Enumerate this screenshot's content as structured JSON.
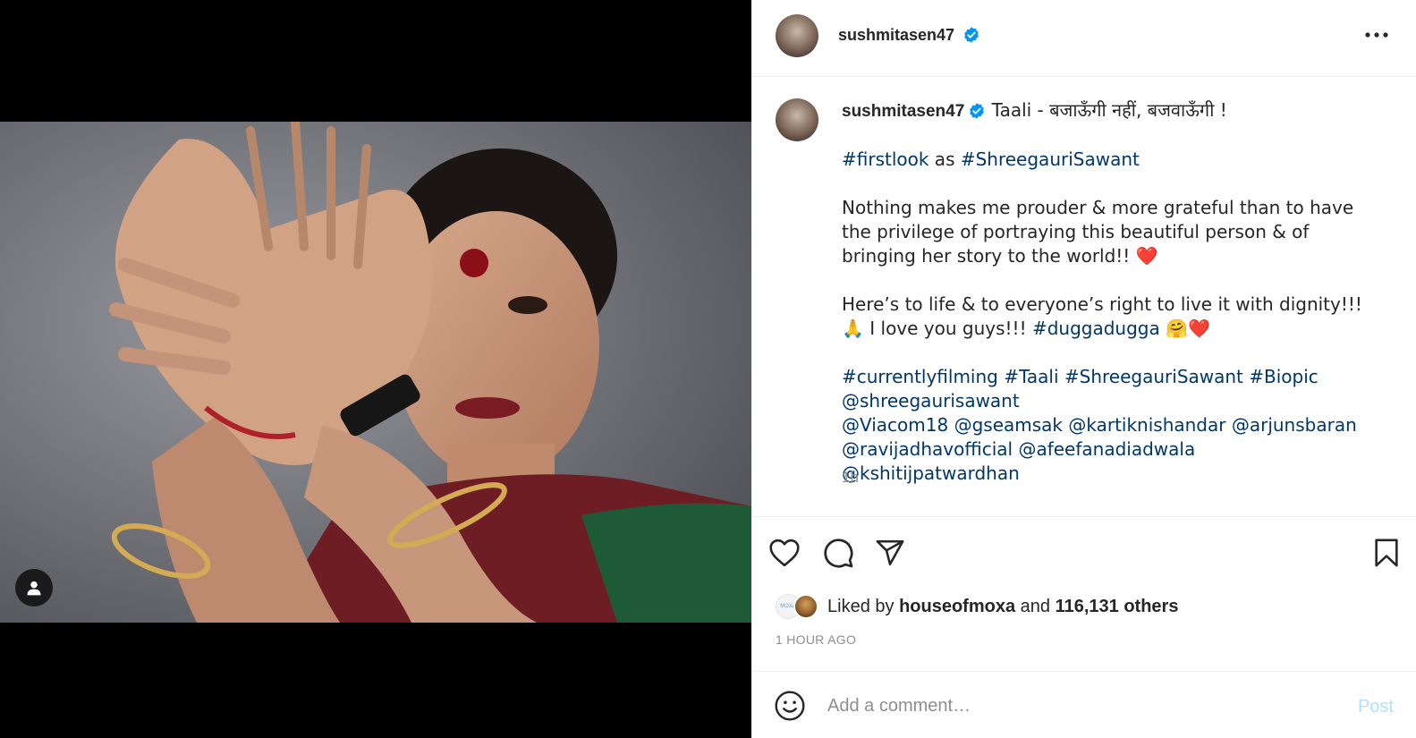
{
  "header": {
    "username": "sushmitasen47",
    "more_icon": "more-horizontal-icon"
  },
  "caption": {
    "username": "sushmitasen47",
    "title_text": "Taali - बजाऊँगी नहीं, बजवाऊँगी !",
    "line2_tag1": "#firstlook",
    "line2_mid": " as ",
    "line2_tag2": "#ShreegauriSawant",
    "para1": "Nothing makes me prouder & more grateful than to have the privilege of portraying this beautiful person & of bringing her story to the world!! ❤️",
    "para2_text": "Here’s to life & to everyone’s right to live it with dignity!!! 🙏 I love you guys!!! ",
    "para2_tag": "#duggadugga",
    "para2_emoji": " 🤗❤️",
    "tags": [
      "#currentlyfilming",
      "#Taali",
      "#ShreegauriSawant",
      "#Biopic",
      "@shreegaurisawant",
      "@Viacom18",
      "@gseamsak",
      "@kartiknishandar",
      "@arjunsbaran",
      "@ravijadhavofficial",
      "@afeefanadiadwala",
      "@kshitijpatwardhan"
    ],
    "time": "1h"
  },
  "likes": {
    "prefix": "Liked by ",
    "user": "houseofmoxa",
    "mid": " and ",
    "count": "116,131 others",
    "moxa_label": "MOXA"
  },
  "timestamp": "1 HOUR AGO",
  "comment": {
    "placeholder": "Add a comment…",
    "post_label": "Post"
  },
  "colors": {
    "link": "#00376b",
    "verified": "#0095f6",
    "muted": "#8e8e8e",
    "post_disabled": "#b2dffc"
  }
}
